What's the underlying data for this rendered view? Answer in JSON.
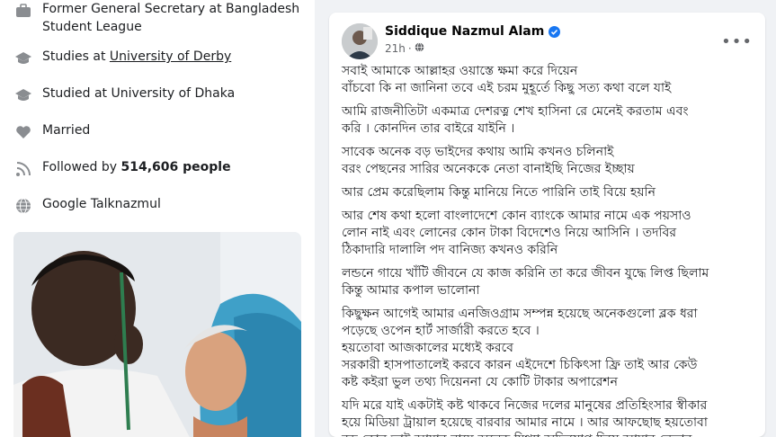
{
  "intro": {
    "work_prefix": "Former General Secretary at Bangladesh Student League",
    "study1_prefix": "Studies at ",
    "study1_link": "University of Derby",
    "study2": "Studied at University of Dhaka",
    "relationship": "Married",
    "followed_prefix": "Followed by ",
    "followed_count": "514,606 people",
    "google": "Google Talknazmul"
  },
  "post": {
    "author": "Siddique Nazmul Alam",
    "time": "21h",
    "paragraphs": [
      [
        "সবাই আমাকে আল্লাহর ওয়াস্তে ক্ষমা করে দিয়েন",
        "বাঁচবো কি না জানিনা তবে এই চরম মুহূর্তে কিছু সত্য কথা বলে যাই"
      ],
      [
        "আমি রাজনীতিটা একমাত্র দেশরত্ন শেখ হাসিনা রে মেনেই করতাম এবং",
        "করি । কোনদিন তার বাইরে যাইনি ।"
      ],
      [
        "সাবেক অনেক বড় ভাইদের কথায় আমি কখনও চলিনাই",
        "বরং পেছনের সারির অনেককে নেতা বানাইছি নিজের ইচ্ছায়"
      ],
      [
        "আর প্রেম করেছিলাম কিন্তু মানিয়ে নিতে পারিনি তাই বিয়ে হয়নি"
      ],
      [
        "আর শেষ কথা হলো বাংলাদেশে কোন ব্যাংকে আমার নামে এক পয়সাও",
        "লোন নাই এবং লোনের কোন টাকা বিদেশেও নিয়ে আসিনি । তদবির",
        "ঠিকাদারি দালালি পদ বানিজ্য কখনও করিনি"
      ],
      [
        "লন্ডনে গায়ে খাঁটি জীবনে যে কাজ করিনি তা করে জীবন যুদ্ধে লিপ্ত ছিলাম",
        "কিন্তু আমার কপাল ভালোনা"
      ],
      [
        "কিছুক্ষন আগেই আমার এনজিওগ্রাম সম্পন্ন হয়েছে অনেকগুলো ব্লক ধরা",
        "পড়েছে ওপেন হার্ট সার্জারী করতে হবে ।",
        "হয়তোবা আজকালের মধ্যেই করবে",
        "সরকারী হাসপাতালেই করবে কারন এইদেশে চিকিৎসা ফ্রি তাই আর কেউ",
        "কষ্ট কইরা ভুল তথ্য দিয়েননা যে কোটি টাকার অপারেশন"
      ],
      [
        "যদি মরে যাই একটাই কষ্ট থাকবে নিজের দলের মানুষের প্রতিহিংসার স্বীকার",
        "হয়ে মিডিয়া ট্রায়াল হয়েছে বারবার আমার নামে । আর আফছোছ হয়তোবা",
        "বড় কোন ভাই আমার নামে অনেক মিথ্যা অভিযোগ দিয়ে আমার নেতার"
      ]
    ]
  },
  "colors": {
    "verified": "#1877f2",
    "muted": "#65676b",
    "bg": "#f0f2f5"
  }
}
